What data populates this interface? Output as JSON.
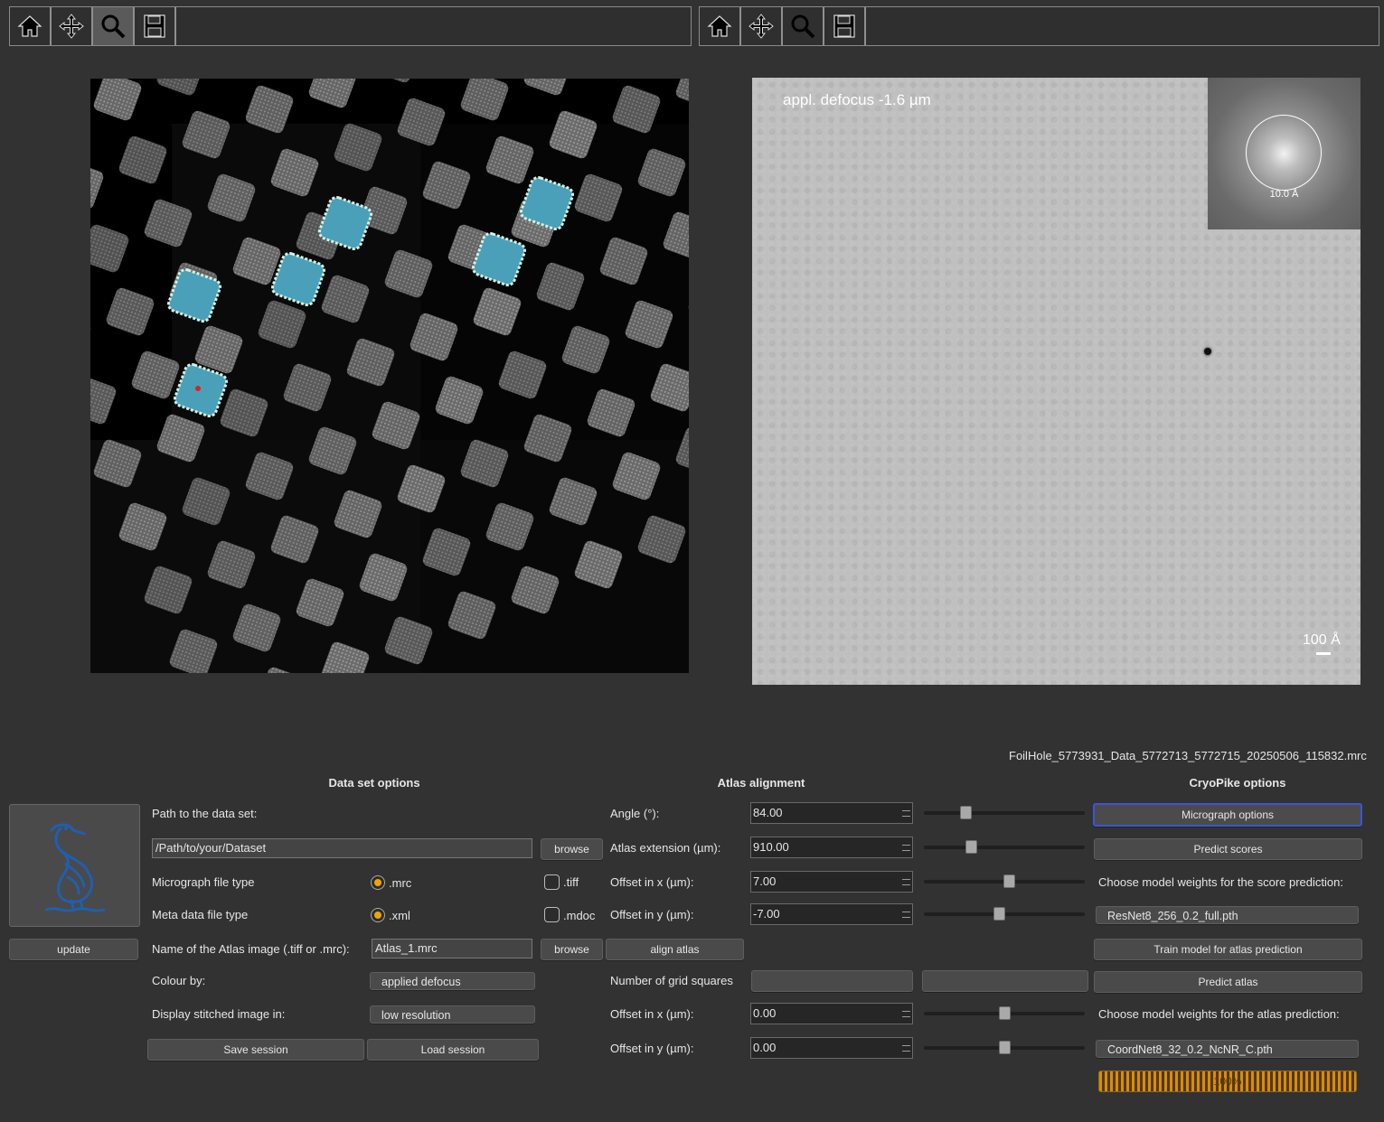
{
  "toolbars": [
    {
      "buttons": [
        "home-icon",
        "pan-icon",
        "zoom-icon",
        "save-icon"
      ],
      "active": "zoom-icon"
    },
    {
      "buttons": [
        "home-icon",
        "pan-icon",
        "zoom-icon",
        "save-icon"
      ],
      "active": ""
    }
  ],
  "micrograph": {
    "defocus_label": "appl. defocus -1.6 µm",
    "fft_label": "10.0 Å",
    "scale_label": "100 Å",
    "filename": "FoilHole_5773931_Data_5772713_5772715_20250506_115832.mrc"
  },
  "dataset": {
    "title": "Data set options",
    "path_label": "Path to the data set:",
    "path_value": "/Path/to/your/Dataset",
    "browse_label": "browse",
    "micrograph_type_label": "Micrograph file type",
    "mrc_label": ".mrc",
    "tiff_label": ".tiff",
    "meta_type_label": "Meta data file type",
    "xml_label": ".xml",
    "mdoc_label": ".mdoc",
    "atlas_name_label": "Name of the Atlas image (.tiff or .mrc):",
    "atlas_name_value": "Atlas_1.mrc",
    "browse2_label": "browse",
    "colour_by_label": "Colour by:",
    "colour_by_value": "applied defocus",
    "display_label": "Display stitched image in:",
    "display_value": "low resolution",
    "save_session": "Save session",
    "load_session": "Load session",
    "update_label": "update"
  },
  "alignment": {
    "title": "Atlas alignment",
    "angle_label": "Angle (°):",
    "angle_value": "84.00",
    "extension_label": "Atlas extension (µm):",
    "extension_value": "910.00",
    "offx_label": "Offset in x (µm):",
    "offx_value": "7.00",
    "offy_label": "Offset in y (µm):",
    "offy_value": "-7.00",
    "align_label": "align atlas",
    "grid_label": "Number of grid squares",
    "offx2_label": "Offset in x (µm):",
    "offx2_value": "0.00",
    "offy2_label": "Offset in y (µm):",
    "offy2_value": "0.00"
  },
  "cryopike": {
    "title": "CryoPike options",
    "micrograph_options": "Micrograph options",
    "predict_scores": "Predict scores",
    "score_weights_label": "Choose model weights for the score prediction:",
    "score_weights_value": "ResNet8_256_0.2_full.pth",
    "train_model": "Train model for atlas prediction",
    "predict_atlas": "Predict atlas",
    "atlas_weights_label": "Choose model weights for the atlas prediction:",
    "atlas_weights_value": "CoordNet8_32_0.2_NcNR_C.pth",
    "progress": "100%",
    "progress_value": 1.0
  }
}
